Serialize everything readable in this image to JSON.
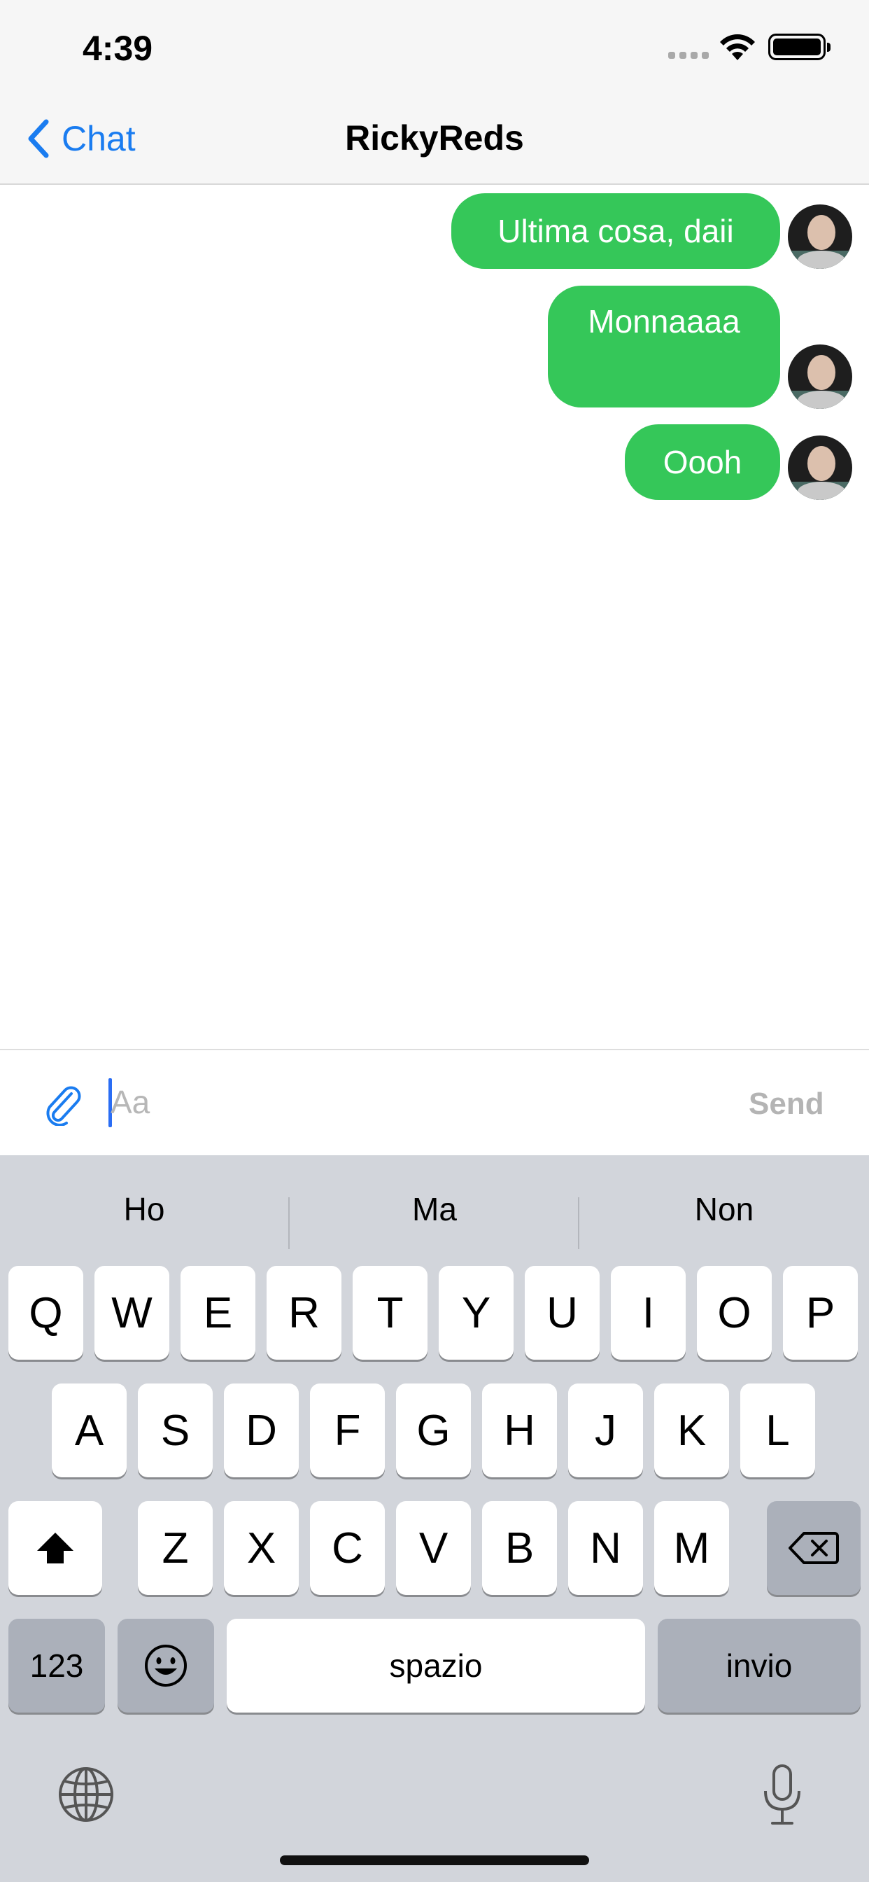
{
  "status_bar": {
    "time": "4:39"
  },
  "nav": {
    "back_label": "Chat",
    "title": "RickyReds"
  },
  "messages": [
    {
      "text": "Ultima cosa, daii",
      "sender": "self"
    },
    {
      "text": "Monnaaaa",
      "sender": "self"
    },
    {
      "text": "Oooh",
      "sender": "self"
    }
  ],
  "input": {
    "placeholder": "Aa",
    "send_label": "Send"
  },
  "keyboard": {
    "suggestions": [
      "Ho",
      "Ma",
      "Non"
    ],
    "row1": [
      "Q",
      "W",
      "E",
      "R",
      "T",
      "Y",
      "U",
      "I",
      "O",
      "P"
    ],
    "row2": [
      "A",
      "S",
      "D",
      "F",
      "G",
      "H",
      "J",
      "K",
      "L"
    ],
    "row3": [
      "Z",
      "X",
      "C",
      "V",
      "B",
      "N",
      "M"
    ],
    "numbers_label": "123",
    "space_label": "spazio",
    "return_label": "invio"
  },
  "colors": {
    "bubble": "#35c759",
    "accent": "#1a7cf0",
    "keyboard_bg": "#d2d5db"
  },
  "icons": [
    "chevron-left-icon",
    "wifi-icon",
    "battery-icon",
    "paperclip-icon",
    "shift-icon",
    "backspace-icon",
    "emoji-icon",
    "globe-icon",
    "microphone-icon"
  ]
}
